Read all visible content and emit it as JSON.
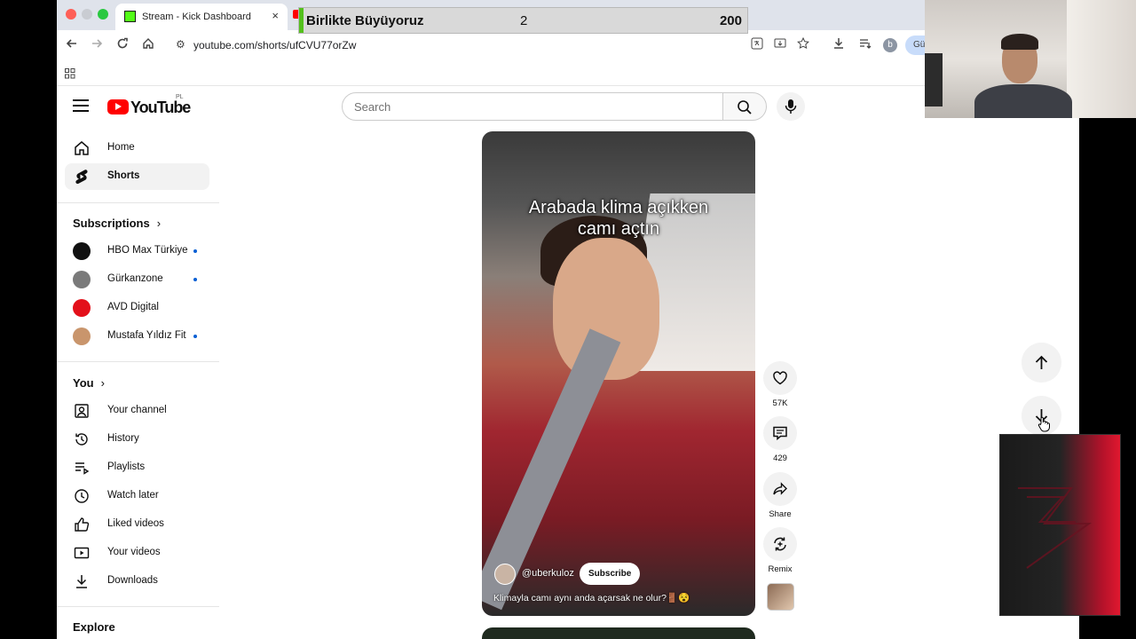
{
  "browser": {
    "tab_active_title": "Stream - Kick Dashboard",
    "tab_close": "×",
    "url": "youtube.com/shorts/ufCVU77orZw",
    "profile_initial": "b",
    "profile_chip": "Gü"
  },
  "overlay": {
    "name": "Birlikte Büyüyoruz",
    "value": "2",
    "goal": "200"
  },
  "youtube": {
    "logo_text": "YouTube",
    "country_code": "PL",
    "search_placeholder": "Search"
  },
  "sidebar": {
    "main": [
      {
        "label": "Home",
        "icon": "home-icon"
      },
      {
        "label": "Shorts",
        "icon": "shorts-icon"
      }
    ],
    "subscriptions_title": "Subscriptions",
    "subscriptions": [
      {
        "label": "HBO Max Türkiye",
        "new": true,
        "color": "#111111"
      },
      {
        "label": "Gürkanzone",
        "new": true,
        "color": "#7a7a7a"
      },
      {
        "label": "AVD Digital",
        "new": false,
        "color": "#e3101a"
      },
      {
        "label": "Mustafa Yıldız Fit",
        "new": true,
        "color": "#c9956c"
      }
    ],
    "you_title": "You",
    "you": [
      {
        "label": "Your channel",
        "icon": "channel-icon"
      },
      {
        "label": "History",
        "icon": "history-icon"
      },
      {
        "label": "Playlists",
        "icon": "playlists-icon"
      },
      {
        "label": "Watch later",
        "icon": "clock-icon"
      },
      {
        "label": "Liked videos",
        "icon": "thumbs-up-icon"
      },
      {
        "label": "Your videos",
        "icon": "video-icon"
      },
      {
        "label": "Downloads",
        "icon": "download-icon"
      }
    ],
    "explore_title": "Explore"
  },
  "short": {
    "caption_line1": "Arabada klima açıkken",
    "caption_line2": "camı açtın",
    "channel": "@uberkuloz",
    "subscribe": "Subscribe",
    "description": "Klimayla camı aynı anda açarsak ne olur?🚪😵"
  },
  "actions": {
    "likes": "57K",
    "comments": "429",
    "share": "Share",
    "remix": "Remix"
  },
  "colors": {
    "accent": "#ff0000",
    "subscription_dot": "#065fd4",
    "kick_green": "#53fc18"
  }
}
